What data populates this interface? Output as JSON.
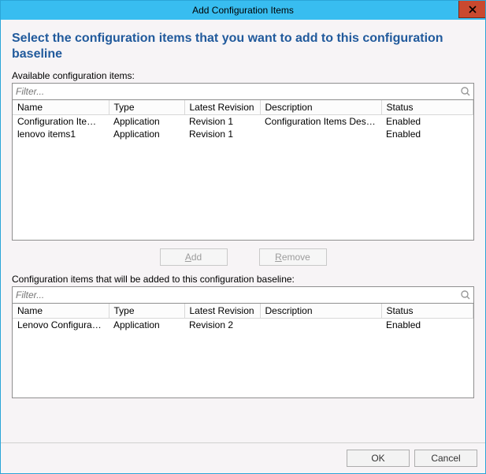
{
  "window": {
    "title": "Add Configuration Items"
  },
  "heading": "Select the configuration items that you want to add to this configuration baseline",
  "labels": {
    "available": "Available configuration items:",
    "added": "Configuration items that will be added to this configuration baseline:"
  },
  "filter": {
    "placeholder1": "Filter...",
    "placeholder2": "Filter..."
  },
  "columns": {
    "name": "Name",
    "type": "Type",
    "revision": "Latest Revision",
    "description": "Description",
    "status": "Status"
  },
  "available_items": [
    {
      "name": "Configuration Items S...",
      "type": "Application",
      "revision": "Revision 1",
      "description": "Configuration Items Descrip...",
      "status": "Enabled"
    },
    {
      "name": "lenovo items1",
      "type": "Application",
      "revision": "Revision 1",
      "description": "",
      "status": "Enabled"
    }
  ],
  "added_items": [
    {
      "name": "Lenovo Configuration...",
      "type": "Application",
      "revision": "Revision 2",
      "description": "",
      "status": "Enabled"
    }
  ],
  "buttons": {
    "add": "Add",
    "remove": "Remove",
    "ok": "OK",
    "cancel": "Cancel"
  }
}
